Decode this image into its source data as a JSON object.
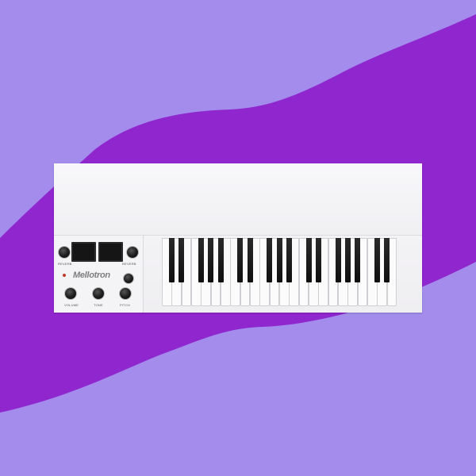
{
  "colors": {
    "background_light": "#a38cec",
    "background_dark": "#9026ce",
    "instrument_body": "#f3f2f5",
    "keys_black": "#111111"
  },
  "panel": {
    "brand": "Mellotron",
    "label_reverb": "REVERB",
    "label_volume": "VOLUME",
    "label_tone": "TONE",
    "label_pitch": "PITCH"
  },
  "keyboard": {
    "white_key_count": 24,
    "black_key_pattern": [
      1,
      1,
      0,
      1,
      1,
      1,
      0
    ]
  }
}
